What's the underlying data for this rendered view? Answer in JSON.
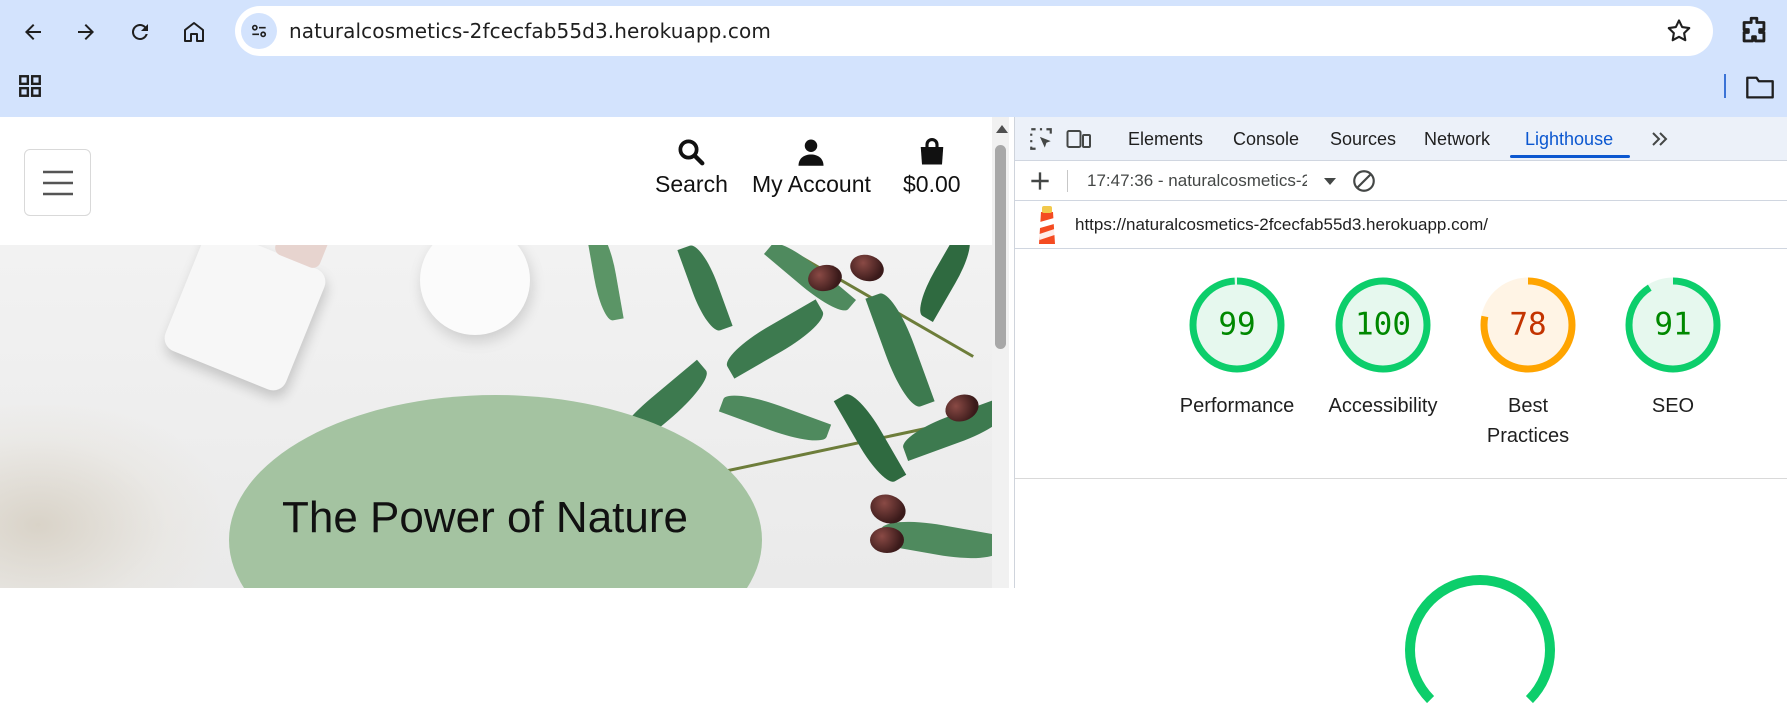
{
  "browser": {
    "url": "naturalcosmetics-2fcecfab55d3.herokuapp.com",
    "icons": [
      "back-icon",
      "forward-icon",
      "reload-icon",
      "home-icon",
      "site-info-icon",
      "bookmark-star-icon",
      "extensions-icon",
      "apps-icon",
      "folder-icon"
    ]
  },
  "site": {
    "header": {
      "search_label": "Search",
      "account_label": "My Account",
      "bag_label": "$0.00"
    },
    "hero": {
      "title": "The Power of Nature"
    },
    "colors": {
      "hero_oval": "#a4c3a1",
      "text": "#111111"
    }
  },
  "devtools": {
    "tabs": [
      {
        "label": "Elements"
      },
      {
        "label": "Console"
      },
      {
        "label": "Sources"
      },
      {
        "label": "Network"
      },
      {
        "label": "Lighthouse",
        "active": true
      }
    ],
    "report_selector": "17:47:36 - naturalcosmetics-2",
    "audited_url": "https://naturalcosmetics-2fcecfab55d3.herokuapp.com/",
    "scores": [
      {
        "value": "99",
        "label": "Performance",
        "color": "#0cce6b",
        "text_color": "#008800",
        "fill": "#e6f8ee"
      },
      {
        "value": "100",
        "label": "Accessibility",
        "color": "#0cce6b",
        "text_color": "#008800",
        "fill": "#e6f8ee"
      },
      {
        "value": "78",
        "label": "Best Practices",
        "color": "#ffa400",
        "text_color": "#c33300",
        "fill": "#fff4e5"
      },
      {
        "value": "91",
        "label": "SEO",
        "color": "#0cce6b",
        "text_color": "#008800",
        "fill": "#e6f8ee"
      }
    ],
    "accent": "#0b57d0"
  }
}
